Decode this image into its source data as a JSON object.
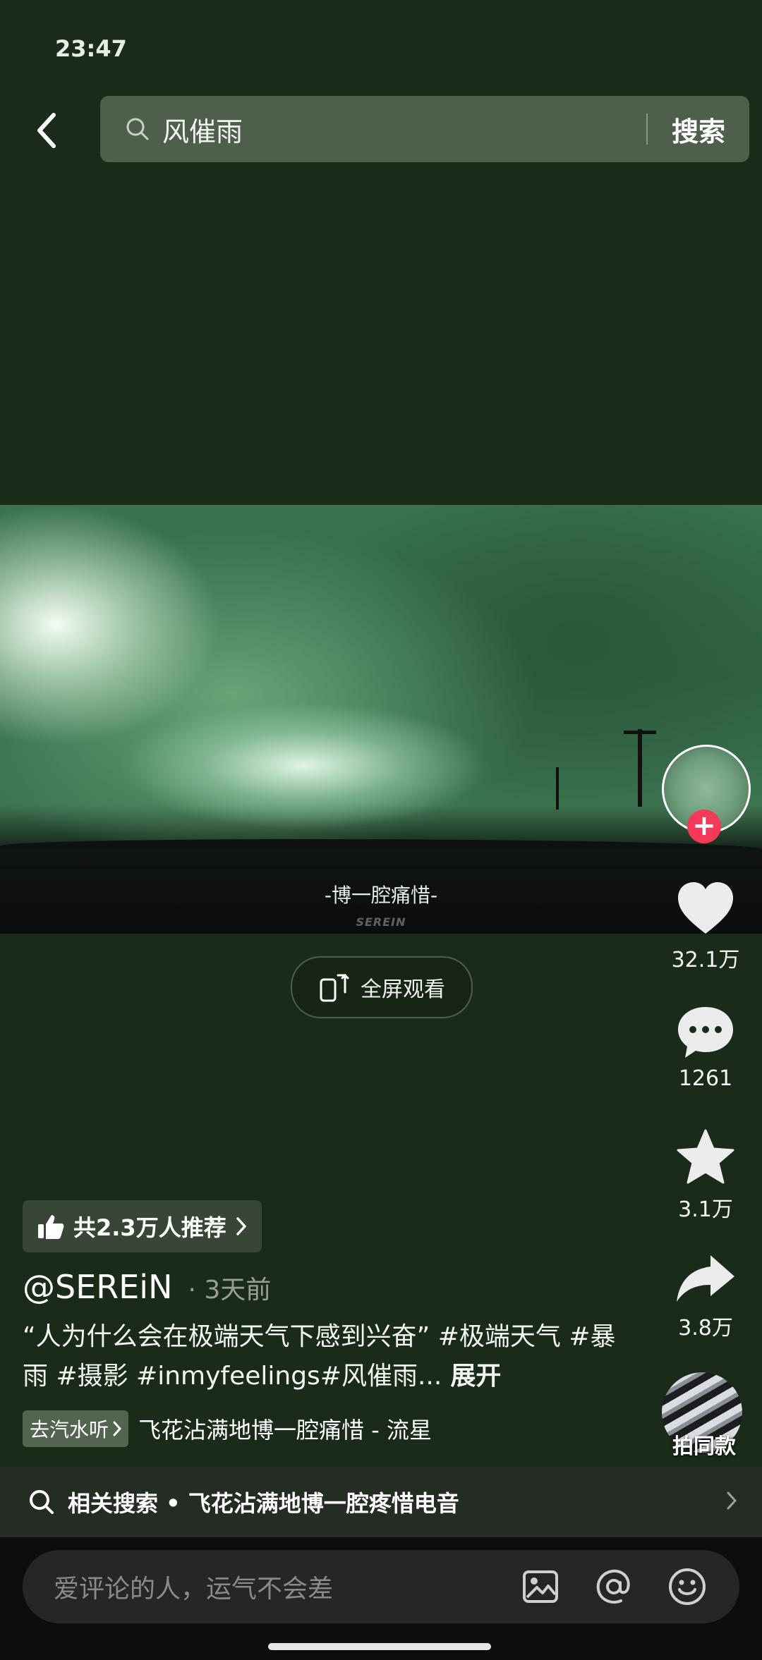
{
  "status_bar": {
    "time": "23:47"
  },
  "search": {
    "query": "风催雨",
    "button": "搜索"
  },
  "video": {
    "caption": "-博一腔痛惜-",
    "watermark": "SEREIN"
  },
  "fullscreen": {
    "label": "全屏观看"
  },
  "actions": {
    "likes": "32.1万",
    "comments": "1261",
    "favorites": "3.1万",
    "shares": "3.8万",
    "same_style": "拍同款"
  },
  "post": {
    "recommend": "共2.3万人推荐",
    "author": "@SEREiN",
    "time_ago": "· 3天前",
    "description": "“人为什么会在极端天气下感到兴奋” #极端天气 #暴雨 #摄影 #inmyfeelings#风催雨...",
    "expand": "展开"
  },
  "music": {
    "tag": "去汽水听",
    "title": "飞花沾满地博一腔痛惜 - 流星"
  },
  "related_search": "相关搜索 • 飞花沾满地博一腔疼惜电音",
  "comment": {
    "placeholder": "爱评论的人，运气不会差"
  }
}
